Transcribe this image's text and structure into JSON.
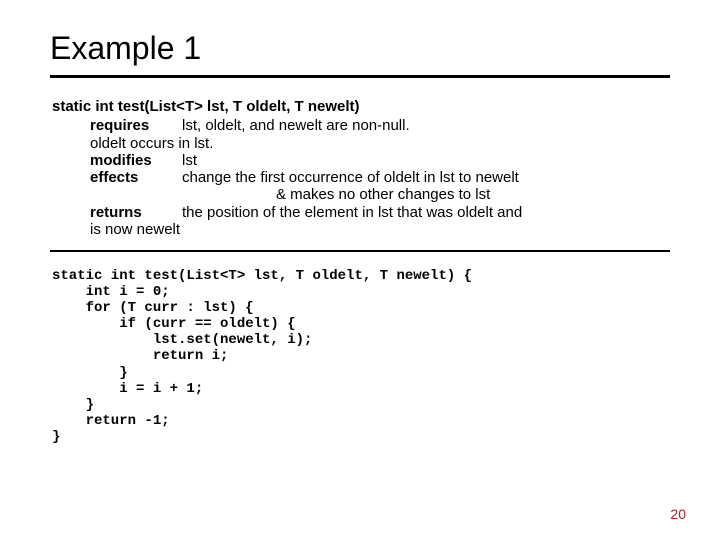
{
  "title": "Example 1",
  "spec": {
    "signature": "static int test(List<T> lst, T oldelt, T newelt)",
    "requires_label": "requires",
    "requires_text": "lst, oldelt, and newelt are non-null.",
    "requires_cont": "oldelt occurs in lst.",
    "modifies_label": "modifies",
    "modifies_text": "lst",
    "effects_label": "effects",
    "effects_text": "change the first occurrence of oldelt in lst to newelt",
    "effects_cont": "& makes no other changes to lst",
    "returns_label": "returns",
    "returns_text": "the position of the element in lst that was oldelt and",
    "returns_cont": "is now newelt"
  },
  "code": "static int test(List<T> lst, T oldelt, T newelt) {\n    int i = 0;\n    for (T curr : lst) {\n        if (curr == oldelt) {\n            lst.set(newelt, i);\n            return i;\n        }\n        i = i + 1;\n    }\n    return -1;\n}",
  "page_number": "20"
}
